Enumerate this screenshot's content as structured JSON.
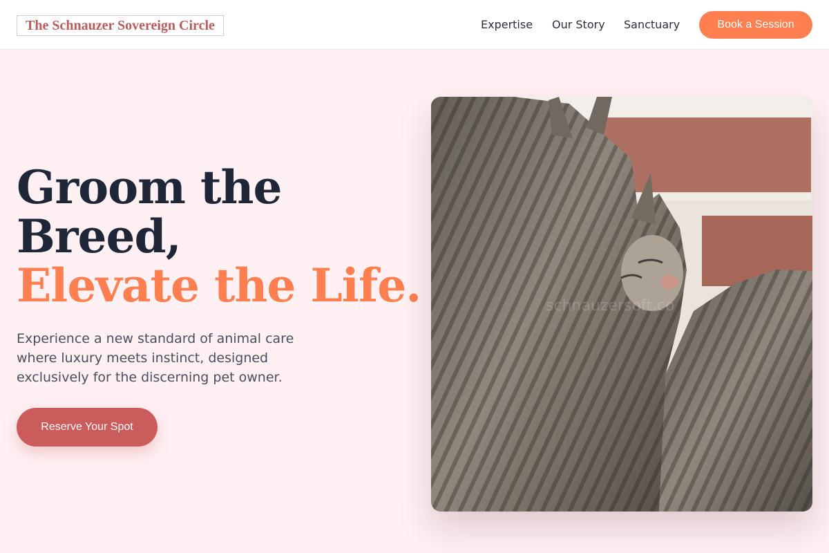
{
  "header": {
    "logo": "The Schnauzer Sovereign Circle",
    "nav": {
      "expertise": "Expertise",
      "story": "Our Story",
      "sanctuary": "Sanctuary"
    },
    "cta_label": "Book a Session"
  },
  "hero": {
    "headline_line1": "Groom the",
    "headline_line2": "Breed,",
    "headline_accent": "Elevate the Life.",
    "subtext": "Experience a new standard of animal care where luxury meets instinct, designed exclusively for the discerning pet owner.",
    "cta_label": "Reserve Your Spot",
    "image": {
      "icon": "cats-photo",
      "watermark": "schnauzersoft.co"
    }
  },
  "colors": {
    "background": "#fff0f3",
    "accent": "#ff7f50",
    "brand": "#cc5b5b",
    "logo": "#b85c5c",
    "heading": "#1e2638"
  }
}
